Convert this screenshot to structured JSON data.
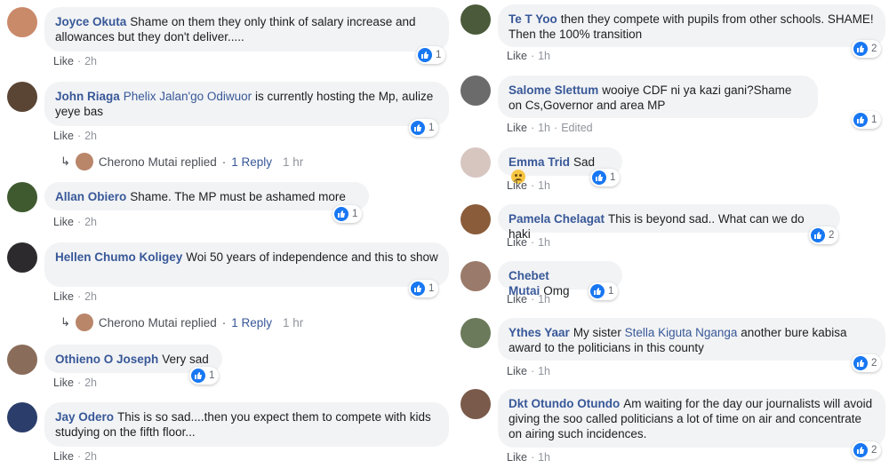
{
  "colors": {
    "accent": "#385898",
    "bubble": "#f2f3f5",
    "like_blue": "#1877f2",
    "meta": "#90949c"
  },
  "icons": {
    "like": "thumbs-up-icon",
    "reply": "reply-arrow-icon",
    "sad": "sad-emoji-icon"
  },
  "left": [
    {
      "author": "Joyce Okuta",
      "text": "Shame on them they only think of salary increase and allowances but they don't deliver.....",
      "like": "Like",
      "time": "2h",
      "count": "1"
    },
    {
      "author": "John Riaga",
      "mention": "Phelix Jalan'go Odiwuor",
      "text": "is currently hosting the Mp, aulize yeye bas",
      "like": "Like",
      "time": "2h",
      "count": "1",
      "reply": {
        "replier": "Cherono Mutai replied",
        "label": "1 Reply",
        "time": "1 hr"
      }
    },
    {
      "author": "Allan Obiero",
      "text": "Shame. The MP must be ashamed more",
      "like": "Like",
      "time": "2h",
      "count": "1"
    },
    {
      "author": "Hellen Chumo Koligey",
      "text": "Woi 50 years of independence and this to show",
      "like": "Like",
      "time": "2h",
      "count": "1",
      "reply": {
        "replier": "Cherono Mutai replied",
        "label": "1 Reply",
        "time": "1 hr"
      }
    },
    {
      "author": "Othieno O Joseph",
      "text": "Very sad",
      "like": "Like",
      "time": "2h",
      "count": "1"
    },
    {
      "author": "Jay Odero",
      "text": "This is so sad....then you expect them to compete with kids studying on the fifth floor...",
      "like": "Like",
      "time": "2h",
      "count": "1"
    }
  ],
  "right": [
    {
      "author": "Te T Yoo",
      "text": "then they compete with pupils from other schools. SHAME! Then the 100% transition",
      "like": "Like",
      "time": "1h",
      "count": "2"
    },
    {
      "author": "Salome Slettum",
      "text": "wooiye CDF ni ya kazi gani?Shame on Cs,Governor and area MP",
      "like": "Like",
      "time": "1h",
      "edited": "Edited",
      "count": "1"
    },
    {
      "author": "Emma Trid",
      "text": "Sad",
      "like": "Like",
      "time": "1h",
      "count": "1"
    },
    {
      "author": "Pamela Chelagat",
      "text": "This is beyond sad.. What can we do haki",
      "like": "Like",
      "time": "1h",
      "count": "2"
    },
    {
      "author": "Chebet Mutai",
      "text": "Omg",
      "like": "Like",
      "time": "1h",
      "count": "1"
    },
    {
      "author": "Ythes Yaar",
      "text": "My sister",
      "mention": "Stella Kiguta Nganga",
      "text2": "another bure kabisa award to the politicians in this county",
      "like": "Like",
      "time": "1h",
      "count": "2"
    },
    {
      "author": "Dkt Otundo Otundo",
      "text": "Am waiting for the day our journalists will avoid giving the soo called politicians a lot of time on air and concentrate on airing such incidences.",
      "like": "Like",
      "time": "1h",
      "count": "2"
    }
  ]
}
